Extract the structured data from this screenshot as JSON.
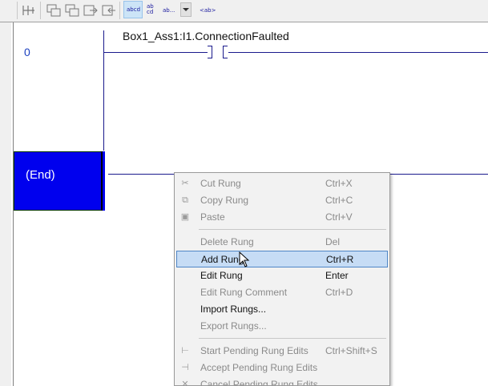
{
  "toolbar": {
    "text_buttons": [
      "abcd",
      "ab cd",
      "ab...",
      "<ab>"
    ]
  },
  "ladder": {
    "rung_number": "0",
    "tag": "Box1_Ass1:I1.ConnectionFaulted",
    "end_label": "(End)"
  },
  "context_menu": {
    "items": [
      {
        "label": "Cut Rung",
        "shortcut": "Ctrl+X",
        "enabled": false,
        "icon": "scissors-icon"
      },
      {
        "label": "Copy Rung",
        "shortcut": "Ctrl+C",
        "enabled": false,
        "icon": "copy-icon"
      },
      {
        "label": "Paste",
        "shortcut": "Ctrl+V",
        "enabled": false,
        "icon": "paste-icon"
      },
      {
        "label": "Delete Rung",
        "shortcut": "Del",
        "enabled": false
      },
      {
        "label": "Add Rung",
        "shortcut": "Ctrl+R",
        "enabled": true,
        "highlighted": true
      },
      {
        "label": "Edit Rung",
        "shortcut": "Enter",
        "enabled": true
      },
      {
        "label": "Edit Rung Comment",
        "shortcut": "Ctrl+D",
        "enabled": false
      },
      {
        "label": "Import Rungs...",
        "shortcut": "",
        "enabled": true
      },
      {
        "label": "Export Rungs...",
        "shortcut": "",
        "enabled": false
      },
      {
        "label": "Start Pending Rung Edits",
        "shortcut": "Ctrl+Shift+S",
        "enabled": false,
        "icon": "start-edits-icon"
      },
      {
        "label": "Accept Pending Rung Edits",
        "shortcut": "",
        "enabled": false,
        "icon": "accept-edits-icon"
      },
      {
        "label": "Cancel Pending Rung Edits",
        "shortcut": "",
        "enabled": false,
        "icon": "cancel-edits-icon"
      }
    ]
  },
  "colors": {
    "end_box": "#0000ee",
    "rung_line": "#1a1a8c",
    "menu_highlight": "#c6dcf5"
  }
}
